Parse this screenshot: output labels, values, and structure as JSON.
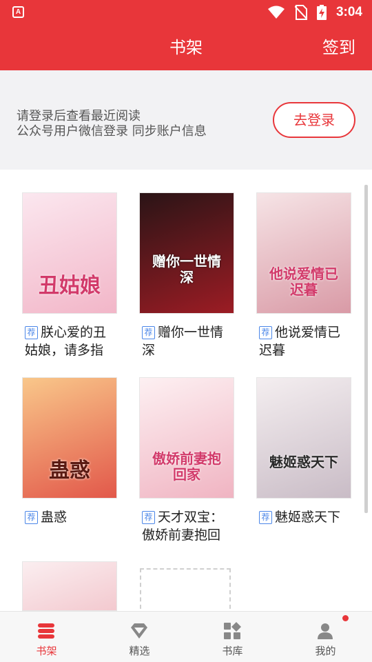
{
  "status_bar": {
    "time": "3:04",
    "app_icon_text": "A"
  },
  "header": {
    "title": "书架",
    "checkin_label": "签到"
  },
  "login_banner": {
    "line1": "请登录后查看最近阅读",
    "line2": "公众号用户微信登录 同步账户信息",
    "button_label": "去登录"
  },
  "books": [
    {
      "tag": "荐",
      "title": "朕心爱的丑姑娘，请多指",
      "cover_text": "丑姑娘",
      "cover_colors": [
        "#fbe7ef",
        "#f2b6c8"
      ]
    },
    {
      "tag": "荐",
      "title": "赠你一世情深",
      "cover_text": "赠你一世情深",
      "cover_colors": [
        "#2a1416",
        "#9c1c24"
      ]
    },
    {
      "tag": "荐",
      "title": "他说爱情已迟暮",
      "cover_text": "他说爱情已迟暮",
      "cover_colors": [
        "#f6e4e6",
        "#d99aa6"
      ]
    },
    {
      "tag": "荐",
      "title": "蛊惑",
      "cover_text": "蛊惑",
      "cover_colors": [
        "#f9c78a",
        "#e2584a"
      ]
    },
    {
      "tag": "荐",
      "title": "天才双宝：傲娇前妻抱回",
      "cover_text": "傲娇前妻抱回家",
      "cover_colors": [
        "#fdf0f2",
        "#f0b4c2"
      ]
    },
    {
      "tag": "荐",
      "title": "魅姬惑天下",
      "cover_text": "魅姬惑天下",
      "cover_colors": [
        "#f4eef0",
        "#c9bcc6"
      ]
    },
    {
      "tag": "",
      "title": "",
      "cover_text": "",
      "cover_colors": [
        "#fbeef0",
        "#f3c9cf"
      ]
    }
  ],
  "tabs": [
    {
      "label": "书架",
      "icon": "bookshelf-icon",
      "active": true
    },
    {
      "label": "精选",
      "icon": "diamond-icon",
      "active": false
    },
    {
      "label": "书库",
      "icon": "library-grid-icon",
      "active": false
    },
    {
      "label": "我的",
      "icon": "user-icon",
      "active": false,
      "has_notification": true
    }
  ],
  "colors": {
    "accent": "#e8363a",
    "tag_blue": "#4a86e8",
    "banner_bg": "#f2f2f4"
  }
}
